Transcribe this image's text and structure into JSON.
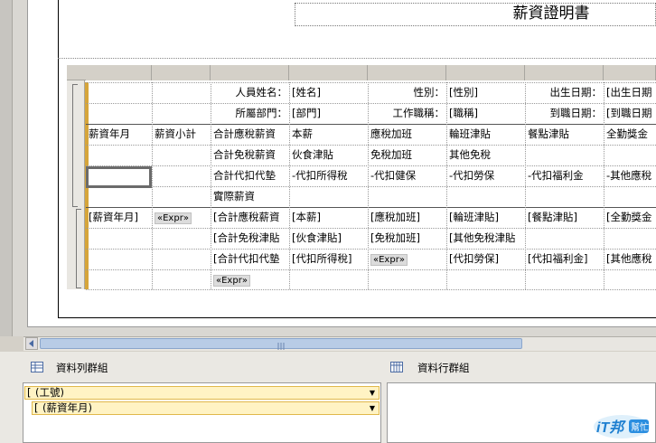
{
  "report": {
    "title": "薪資證明書"
  },
  "tablix": {
    "rows": [
      [
        "",
        "",
        "人員姓名：",
        "[姓名]",
        "性別：",
        "[性別]",
        "出生日期：",
        "[出生日期"
      ],
      [
        "",
        "",
        "所屬部門：",
        "[部門]",
        "工作職稱：",
        "[職稱]",
        "到職日期：",
        "[到職日期"
      ],
      [
        "薪資年月",
        "薪資小計",
        "合計應稅薪資",
        "本薪",
        "應稅加班",
        "輪班津貼",
        "餐點津貼",
        "全勤獎金"
      ],
      [
        "",
        "",
        "合計免稅薪資",
        "伙食津貼",
        "免稅加班",
        "其他免稅",
        "",
        ""
      ],
      [
        "",
        "",
        "合計代扣代墊",
        "-代扣所得稅",
        "-代扣健保",
        "-代扣勞保",
        "-代扣福利金",
        "-其他應稅"
      ],
      [
        "",
        "",
        "實際薪資",
        "",
        "",
        "",
        "",
        ""
      ],
      [
        "[薪資年月]",
        "«Expr»",
        "[合計應稅薪資",
        "[本薪]",
        "[應稅加班]",
        "[輪班津貼]",
        "[餐點津貼]",
        "[全勤獎金"
      ],
      [
        "",
        "",
        "[合計免稅津貼",
        "[伙食津貼]",
        "[免稅加班]",
        "[其他免稅津貼",
        "",
        ""
      ],
      [
        "",
        "",
        "[合計代扣代墊",
        "[代扣所得稅]",
        "«Expr»",
        "[代扣勞保]",
        "[代扣福利金]",
        "[其他應稅"
      ],
      [
        "",
        "",
        "«Expr»",
        "",
        "",
        "",
        "",
        ""
      ]
    ]
  },
  "grouping": {
    "row_groups_title": "資料列群組",
    "column_groups_title": "資料行群組",
    "row_groups": [
      "(工號)",
      "(薪資年月)"
    ]
  },
  "logo": {
    "text_main": "iT邦",
    "text_sub": "幫忙"
  },
  "colors": {
    "group_bar": "#d6a53a",
    "scroll_thumb": "#b8cce6",
    "group_item_bg": "#fff3c4"
  }
}
